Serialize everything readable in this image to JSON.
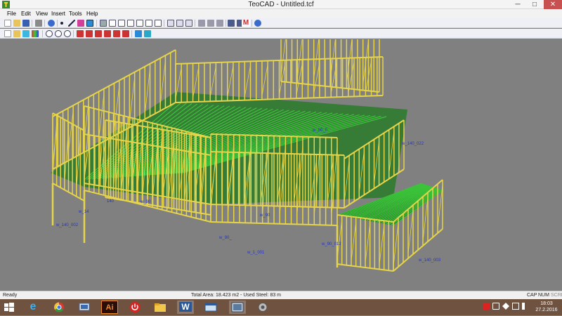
{
  "window": {
    "title": "TeoCAD - Untitled.tcf",
    "minimize": "─",
    "maximize": "□",
    "close": "✕"
  },
  "menu": {
    "items": [
      "File",
      "Edit",
      "View",
      "Insert",
      "Tools",
      "Help"
    ]
  },
  "toolbar1": {
    "icons": [
      "new-file-icon",
      "open-folder-icon",
      "save-icon",
      "print-icon",
      "undo-icon",
      "point-icon",
      "line-icon",
      "select-icon",
      "grid-icon",
      "copy-icon",
      "wall-icon",
      "wall-icon",
      "wall-icon",
      "wall-icon",
      "wall-icon",
      "wall-icon",
      "panel-icon",
      "panel-icon",
      "panel-icon",
      "move-icon",
      "move-icon",
      "move-icon",
      "truss-icon",
      "truss-icon",
      "material-icon",
      "help-icon"
    ]
  },
  "toolbar2": {
    "icons": [
      "new-file-icon",
      "open-folder-icon",
      "layer-icon",
      "color-icon",
      "zoom-in-icon",
      "zoom-out-icon",
      "zoom-extents-icon",
      "view-icon",
      "view-icon",
      "view-icon",
      "view-icon",
      "view-icon",
      "view-icon",
      "render-icon",
      "render-icon"
    ]
  },
  "viewport": {
    "labels": [
      "w_140_002",
      "w_14",
      "140",
      "w_90",
      "w_90_",
      "w_1_001",
      "w_90_012",
      "w_140_003",
      "w_140_022",
      "w_90_0",
      "w_90"
    ]
  },
  "status": {
    "ready": "Ready",
    "info": "Total Area: 18.423 m2  - Used Steel: 83 m",
    "cap": "CAP",
    "num": "NUM",
    "scrl": "SCRL"
  },
  "taskbar": {
    "apps": [
      "internet-explorer-icon",
      "chrome-icon",
      "remote-desktop-icon",
      "illustrator-icon",
      "power-icon",
      "file-explorer-icon",
      "word-icon",
      "window-icon",
      "teocad-icon"
    ],
    "ie_label": "e",
    "chrome_label": "",
    "illustrator_label": "Ai",
    "word_label": "W",
    "time": "18:03",
    "date": "27.2.2016"
  },
  "colors": {
    "accent": "#2a5db0",
    "frame_yellow": "#e6d44a",
    "joist_green": "#3cc43a",
    "label_blue": "#2233cc"
  }
}
